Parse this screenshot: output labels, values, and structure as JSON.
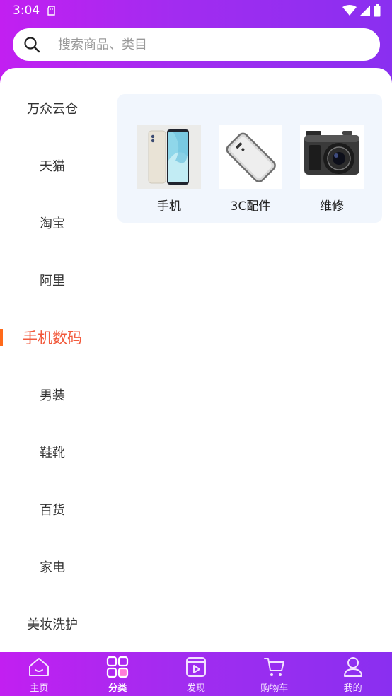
{
  "status_bar": {
    "time": "3:04"
  },
  "search": {
    "placeholder": "搜索商品、类目"
  },
  "categories": [
    {
      "label": "万众云仓"
    },
    {
      "label": "天猫"
    },
    {
      "label": "淘宝"
    },
    {
      "label": "阿里"
    },
    {
      "label": "手机数码",
      "active": true
    },
    {
      "label": "男装"
    },
    {
      "label": "鞋靴"
    },
    {
      "label": "百货"
    },
    {
      "label": "家电"
    },
    {
      "label": "美妆洗护"
    }
  ],
  "products": [
    {
      "label": "手机",
      "icon": "phone-image"
    },
    {
      "label": "3C配件",
      "icon": "phone-case-image"
    },
    {
      "label": "维修",
      "icon": "camera-image"
    }
  ],
  "tabbar": [
    {
      "label": "主页",
      "icon": "home-icon"
    },
    {
      "label": "分类",
      "icon": "category-icon",
      "active": true
    },
    {
      "label": "发现",
      "icon": "discover-icon"
    },
    {
      "label": "购物车",
      "icon": "cart-icon"
    },
    {
      "label": "我的",
      "icon": "profile-icon"
    }
  ],
  "colors": {
    "brand_gradient_start": "#c21ff1",
    "brand_gradient_end": "#8a2ff0",
    "active_category": "#f25a3c",
    "indicator": "#ff6a1a",
    "panel_bg": "#f1f6fd"
  }
}
